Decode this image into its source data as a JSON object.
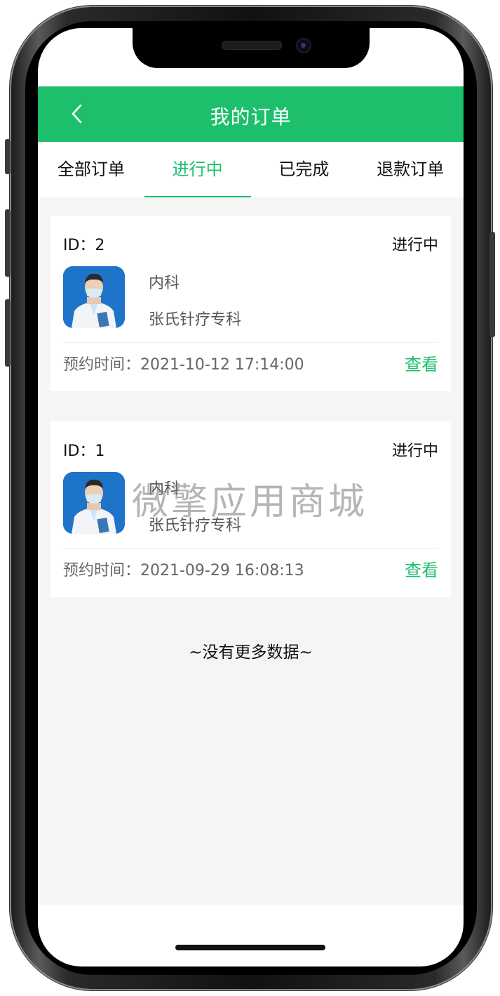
{
  "header": {
    "title": "我的订单"
  },
  "tabs": [
    {
      "label": "全部订单",
      "active": false
    },
    {
      "label": "进行中",
      "active": true
    },
    {
      "label": "已完成",
      "active": false
    },
    {
      "label": "退款订单",
      "active": false
    }
  ],
  "orders": [
    {
      "id_text": "ID：2",
      "status": "进行中",
      "department": "内科",
      "clinic": "张氏针疗专科",
      "time_text": "预约时间：2021-10-12 17:14:00",
      "action": "查看"
    },
    {
      "id_text": "ID：1",
      "status": "进行中",
      "department": "内科",
      "clinic": "张氏针疗专科",
      "time_text": "预约时间：2021-09-29 16:08:13",
      "action": "查看"
    }
  ],
  "footer": {
    "no_more": "~没有更多数据~"
  },
  "watermark": "微擎应用商城",
  "colors": {
    "accent": "#1dbf6d",
    "background": "#f5f5f5"
  },
  "icons": {
    "back": "chevron-left-icon",
    "avatar": "doctor-avatar"
  }
}
